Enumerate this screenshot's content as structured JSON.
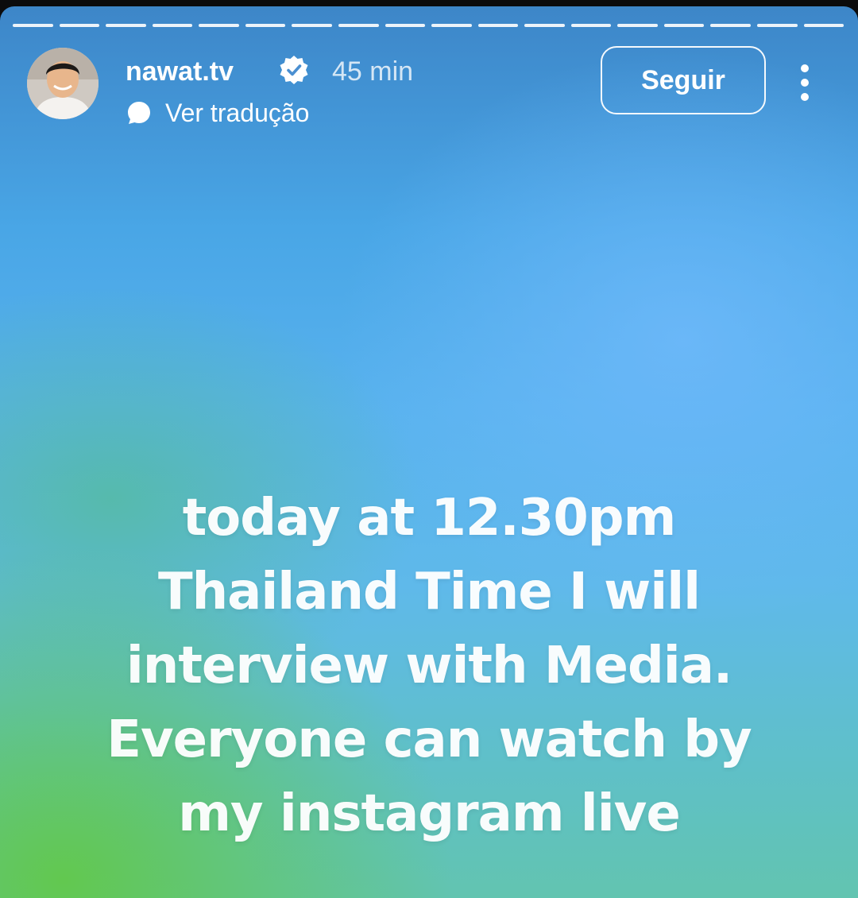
{
  "story": {
    "progress_segments": 18,
    "background_colors": [
      "#3d86c8",
      "#58b2ee",
      "#62c4b0",
      "#62c84a"
    ]
  },
  "header": {
    "username": "nawat.tv",
    "verified": true,
    "posted_ago": "45 min",
    "translate_label": "Ver tradução",
    "follow_label": "Seguir",
    "more_icon": "more-vertical-icon"
  },
  "caption": {
    "lines": [
      "today  at 12.30pm",
      "Thailand Time I will",
      "interview with Media.",
      "Everyone can watch by",
      "my instagram live"
    ]
  }
}
